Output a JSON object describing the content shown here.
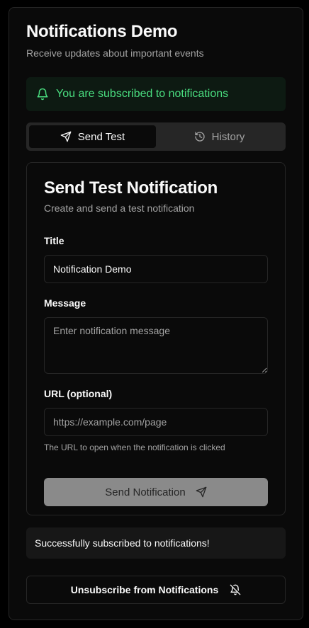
{
  "app": {
    "title": "Notifications Demo",
    "subtitle": "Receive updates about important events"
  },
  "status_banner": {
    "icon": "bell-icon",
    "text": "You are subscribed to notifications",
    "color": "#4ade80"
  },
  "tabs": [
    {
      "label": "Send Test",
      "icon": "send-icon",
      "active": true
    },
    {
      "label": "History",
      "icon": "history-icon",
      "active": false
    }
  ],
  "send_form": {
    "title": "Send Test Notification",
    "subtitle": "Create and send a test notification",
    "title_field": {
      "label": "Title",
      "value": "Notification Demo"
    },
    "message_field": {
      "label": "Message",
      "value": "",
      "placeholder": "Enter notification message"
    },
    "url_field": {
      "label": "URL (optional)",
      "value": "",
      "placeholder": "https://example.com/page",
      "help": "The URL to open when the notification is clicked"
    },
    "submit_label": "Send Notification",
    "submit_icon": "send-icon"
  },
  "toast": {
    "text": "Successfully subscribed to notifications!"
  },
  "unsubscribe": {
    "label": "Unsubscribe from Notifications",
    "icon": "bell-off-icon"
  },
  "colors": {
    "background": "#000000",
    "card": "#0a0a0a",
    "border": "#262626",
    "success": "#4ade80",
    "muted_text": "#a3a3a3",
    "disabled_button": "#8a8a8a"
  }
}
